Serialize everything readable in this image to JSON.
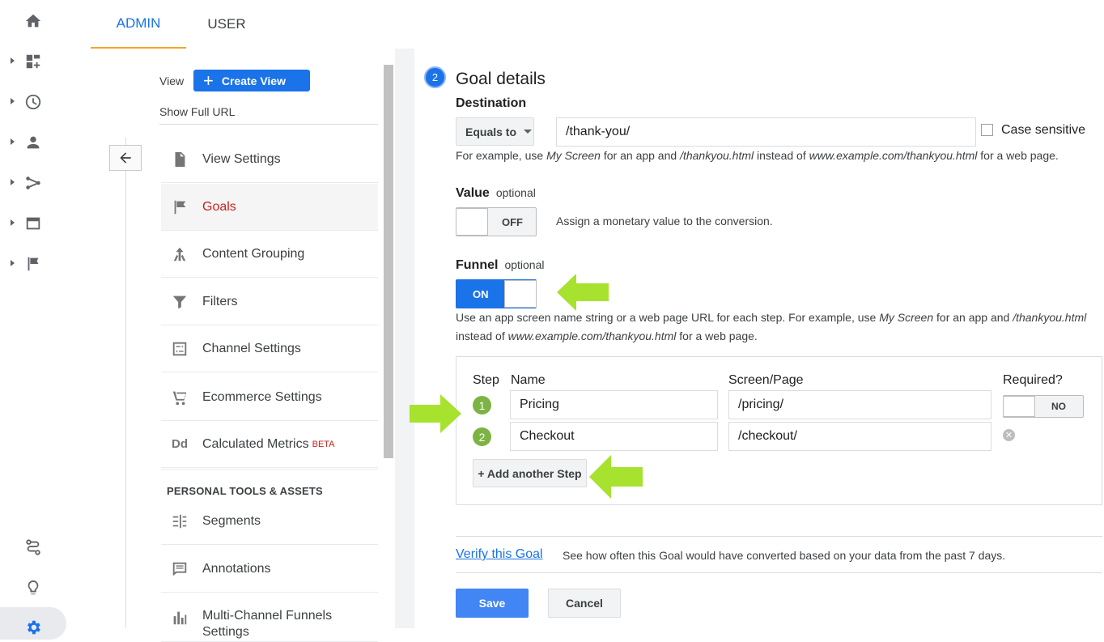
{
  "tabs": {
    "admin": "ADMIN",
    "user": "USER"
  },
  "view": {
    "label": "View",
    "create_label": "Create View",
    "show_url": "Show Full URL"
  },
  "nav": {
    "items": [
      {
        "label": "View Settings",
        "icon": "document-icon"
      },
      {
        "label": "Goals",
        "icon": "flag-icon"
      },
      {
        "label": "Content Grouping",
        "icon": "content-grouping-icon"
      },
      {
        "label": "Filters",
        "icon": "filter-icon"
      },
      {
        "label": "Channel Settings",
        "icon": "channel-settings-icon"
      },
      {
        "label": "Ecommerce Settings",
        "icon": "cart-icon"
      },
      {
        "label": "Calculated Metrics",
        "icon": "dd-icon",
        "badge": "BETA",
        "icon_text": "Dd"
      }
    ],
    "section_title": "PERSONAL TOOLS & ASSETS",
    "tools": [
      {
        "label": "Segments",
        "icon": "segments-icon"
      },
      {
        "label": "Annotations",
        "icon": "annotations-icon"
      },
      {
        "label": "Multi-Channel Funnels Settings",
        "icon": "bar-chart-icon"
      }
    ]
  },
  "goal": {
    "step_number": "2",
    "title": "Goal details",
    "destination": {
      "label": "Destination",
      "match_type": "Equals to",
      "value": "/thank-you/",
      "case_sensitive_label": "Case sensitive",
      "hint_parts": [
        "For example, use ",
        "My Screen",
        " for an app and ",
        "/thankyou.html",
        " instead of ",
        "www.example.com/thankyou.html",
        " for a web page."
      ]
    },
    "value_field": {
      "label": "Value",
      "optional": "optional",
      "toggle": "OFF",
      "hint": "Assign a monetary value to the conversion."
    },
    "funnel": {
      "label": "Funnel",
      "optional": "optional",
      "toggle": "ON",
      "hint_line1_parts": [
        "Use an app screen name string or a web page URL for each step. For example, use ",
        "My Screen",
        " for an app and ",
        "/thankyou.html"
      ],
      "hint_line2_parts": [
        "instead of ",
        "www.example.com/thankyou.html",
        " for a web page."
      ],
      "columns": {
        "step": "Step",
        "name": "Name",
        "screen": "Screen/Page",
        "required": "Required?"
      },
      "steps": [
        {
          "num": "1",
          "name": "Pricing",
          "screen": "/pricing/"
        },
        {
          "num": "2",
          "name": "Checkout",
          "screen": "/checkout/"
        }
      ],
      "required_toggle": "NO",
      "add_step": "+ Add another Step"
    },
    "verify_link": "Verify this Goal",
    "verify_hint": "See how often this Goal would have converted based on your data from the past 7 days.",
    "save": "Save",
    "cancel": "Cancel"
  },
  "colors": {
    "accent": "#1a73e8",
    "active_nav": "#c5221f",
    "step_badge": "#7cb342",
    "highlight_arrow": "#a6e22e"
  }
}
